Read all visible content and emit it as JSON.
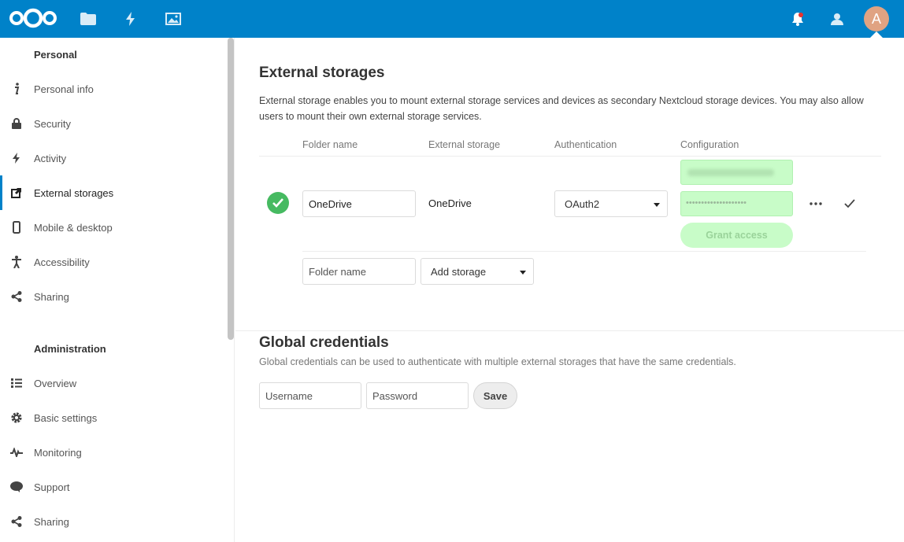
{
  "header": {
    "nav_icons": [
      "files-icon",
      "activity-icon",
      "photos-icon"
    ],
    "right_icons": [
      "notifications-icon",
      "contacts-icon"
    ],
    "avatar_letter": "A",
    "brand_color": "#0082c9"
  },
  "sidebar": {
    "personal_caption": "Personal",
    "personal_items": [
      {
        "label": "Personal info",
        "icon": "info-icon"
      },
      {
        "label": "Security",
        "icon": "lock-icon"
      },
      {
        "label": "Activity",
        "icon": "lightning-icon"
      },
      {
        "label": "External storages",
        "icon": "external-link-icon",
        "active": true
      },
      {
        "label": "Mobile & desktop",
        "icon": "phone-icon"
      },
      {
        "label": "Accessibility",
        "icon": "accessibility-icon"
      },
      {
        "label": "Sharing",
        "icon": "share-icon"
      }
    ],
    "admin_caption": "Administration",
    "admin_items": [
      {
        "label": "Overview",
        "icon": "list-icon"
      },
      {
        "label": "Basic settings",
        "icon": "gear-icon"
      },
      {
        "label": "Monitoring",
        "icon": "pulse-icon"
      },
      {
        "label": "Support",
        "icon": "chat-icon"
      },
      {
        "label": "Sharing",
        "icon": "share-icon"
      }
    ]
  },
  "external": {
    "title": "External storages",
    "description": "External storage enables you to mount external storage services and devices as secondary Nextcloud storage devices. You may also allow users to mount their own external storage services.",
    "columns": {
      "folder": "Folder name",
      "storage": "External storage",
      "auth": "Authentication",
      "config": "Configuration"
    },
    "row": {
      "folder_value": "OneDrive",
      "storage": "OneDrive",
      "auth": "OAuth2",
      "secret_masked": "••••••••••••••••••••",
      "grant_label": "Grant access"
    },
    "new_row": {
      "folder_placeholder": "Folder name",
      "add_storage": "Add storage"
    }
  },
  "global": {
    "title": "Global credentials",
    "description": "Global credentials can be used to authenticate with multiple external storages that have the same credentials.",
    "username_placeholder": "Username",
    "password_placeholder": "Password",
    "save_label": "Save"
  }
}
